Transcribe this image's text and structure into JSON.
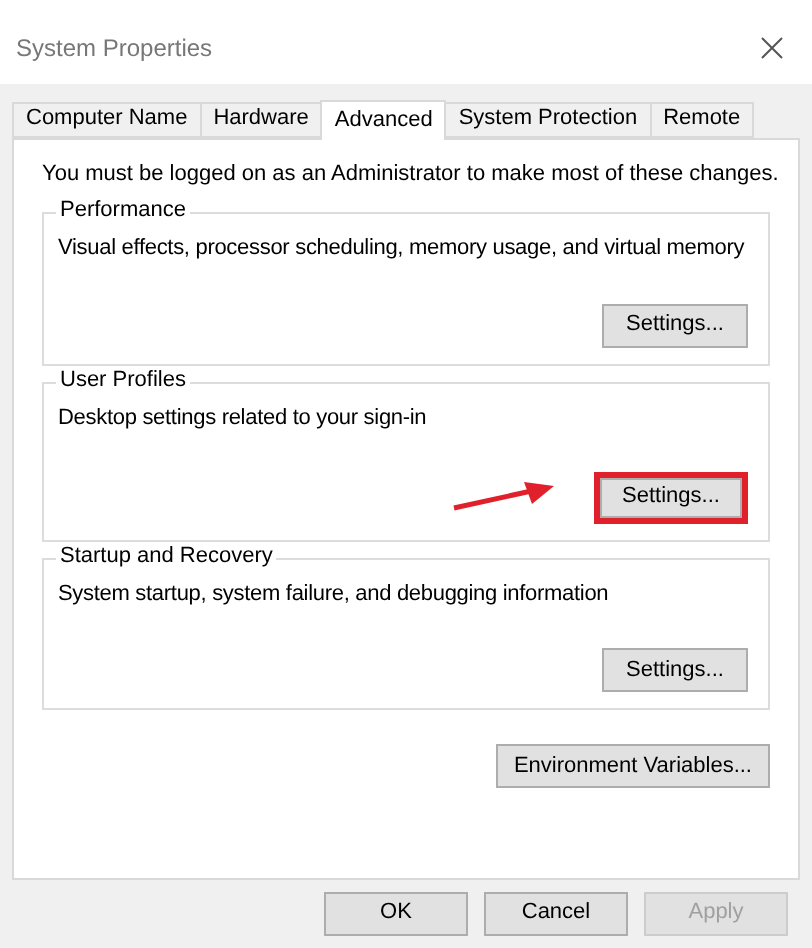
{
  "window": {
    "title": "System Properties"
  },
  "tabs": [
    {
      "label": "Computer Name",
      "selected": false
    },
    {
      "label": "Hardware",
      "selected": false
    },
    {
      "label": "Advanced",
      "selected": true
    },
    {
      "label": "System Protection",
      "selected": false
    },
    {
      "label": "Remote",
      "selected": false
    }
  ],
  "notice": "You must be logged on as an Administrator to make most of these changes.",
  "groups": [
    {
      "title": "Performance",
      "description": "Visual effects, processor scheduling, memory usage, and virtual memory",
      "button": "Settings...",
      "highlighted": false
    },
    {
      "title": "User Profiles",
      "description": "Desktop settings related to your sign-in",
      "button": "Settings...",
      "highlighted": true
    },
    {
      "title": "Startup and Recovery",
      "description": "System startup, system failure, and debugging information",
      "button": "Settings...",
      "highlighted": false
    }
  ],
  "environment_button": "Environment Variables...",
  "buttons": [
    {
      "label": "OK",
      "disabled": false
    },
    {
      "label": "Cancel",
      "disabled": false
    },
    {
      "label": "Apply",
      "disabled": true
    }
  ]
}
